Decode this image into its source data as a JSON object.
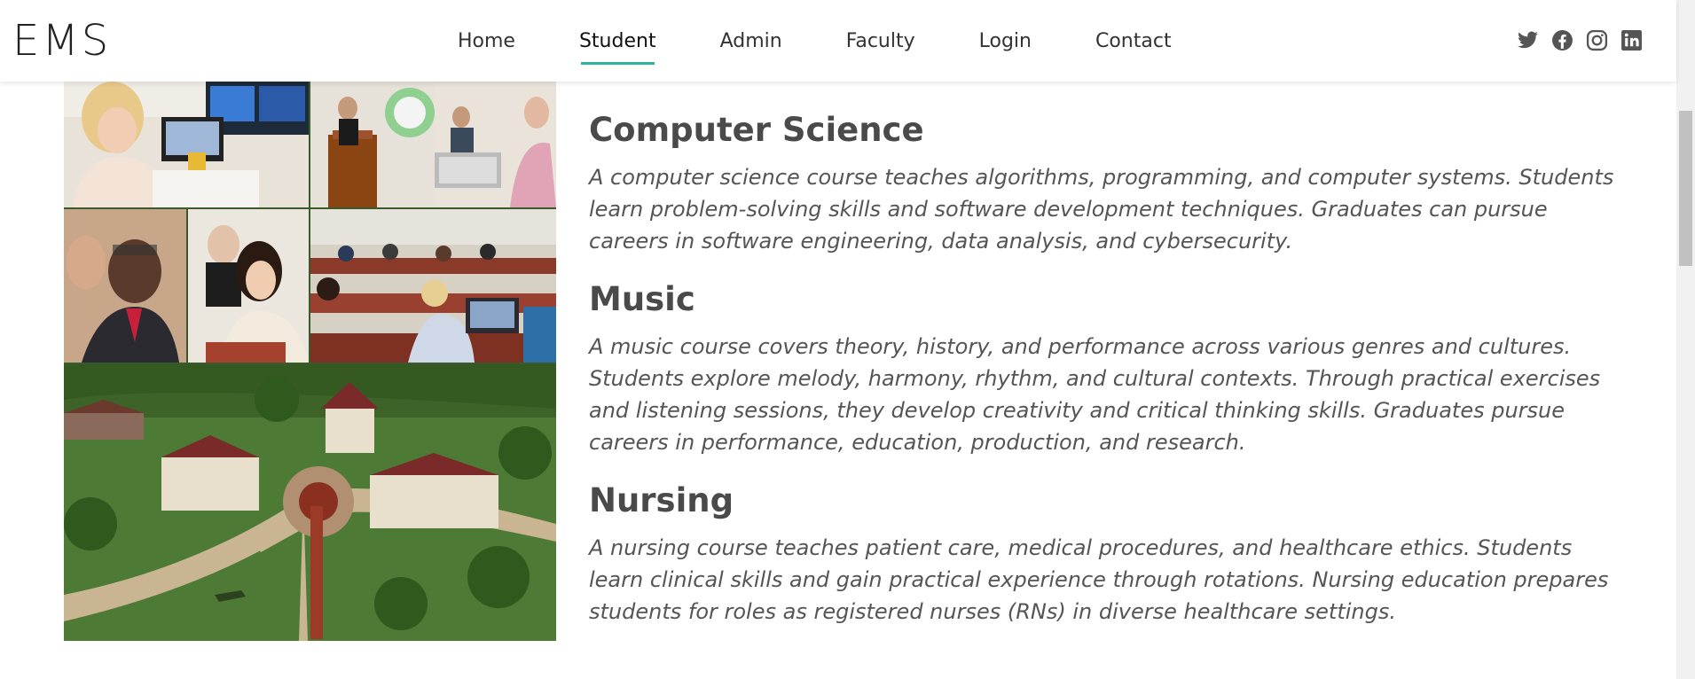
{
  "navbar": {
    "brand": "EMS",
    "links": [
      "Home",
      "Student",
      "Admin",
      "Faculty",
      "Login",
      "Contact"
    ],
    "active_link": "Student",
    "accent_color": "#2bb3a0",
    "social_icons": [
      "twitter-icon",
      "facebook-icon",
      "instagram-icon",
      "linkedin-icon"
    ]
  },
  "collage": {
    "photos": [
      "students-at-computers",
      "lecture-podium",
      "students-on-laptops",
      "smiling-instructor",
      "student-writing",
      "lecture-hall",
      "campus-aerial-view"
    ]
  },
  "courses": [
    {
      "title": "Computer Science",
      "description": "A computer science course teaches algorithms, programming, and computer systems. Students learn problem-solving skills and software development techniques. Graduates can pursue careers in software engineering, data analysis, and cybersecurity."
    },
    {
      "title": "Music",
      "description": "A music course covers theory, history, and performance across various genres and cultures. Students explore melody, harmony, rhythm, and cultural contexts. Through practical exercises and listening sessions, they develop creativity and critical thinking skills. Graduates pursue careers in performance, education, production, and research."
    },
    {
      "title": "Nursing",
      "description": "A nursing course teaches patient care, medical procedures, and healthcare ethics. Students learn clinical skills and gain practical experience through rotations. Nursing education prepares students for roles as registered nurses (RNs) in diverse healthcare settings."
    }
  ]
}
